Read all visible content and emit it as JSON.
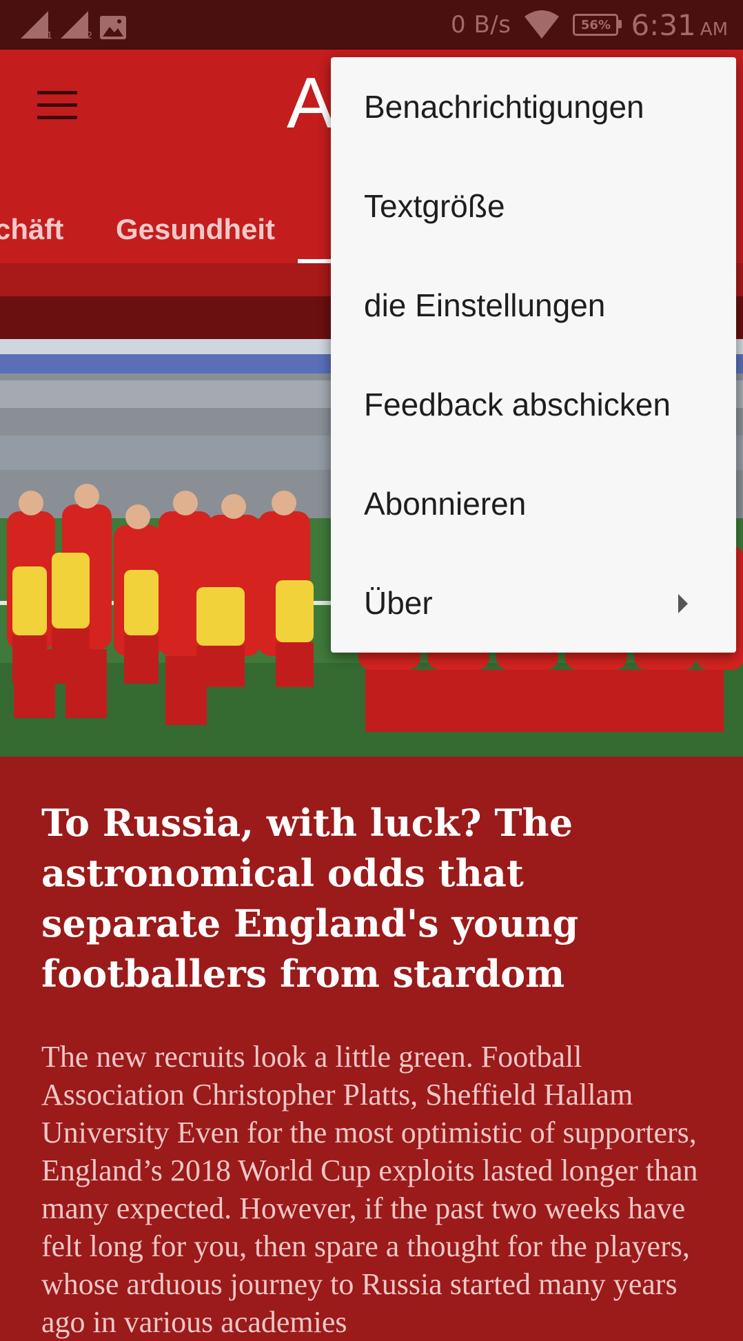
{
  "status_bar": {
    "sim1_label": "1",
    "sim2_label": "2",
    "net_speed": "0 B/s",
    "battery_level": "56%",
    "time": "6:31",
    "am_pm": "AM",
    "icons": [
      "signal-icon",
      "signal-icon",
      "image-icon",
      "wifi-icon",
      "battery-icon"
    ]
  },
  "app_bar": {
    "logo_text": "A",
    "icons": [
      "menu-icon"
    ],
    "tabs": [
      {
        "label": "chäft"
      },
      {
        "label": "Gesundheit"
      }
    ]
  },
  "popup_menu": {
    "items": [
      {
        "label": "Benachrichtigungen"
      },
      {
        "label": "Textgröße"
      },
      {
        "label": "die Einstellungen"
      },
      {
        "label": "Feedback abschicken"
      },
      {
        "label": "Abonnieren"
      },
      {
        "label": "Über"
      }
    ]
  },
  "article": {
    "headline": "To Russia, with luck? The astronomical odds that separate England's young footballers from stardom",
    "body": "The new recruits look a little green. Football Association Christopher Platts, Sheffield Hallam University Even for the most optimistic of supporters, England’s 2018 World Cup exploits lasted longer than many expected. However, if the past two weeks have felt long for you, then spare a thought for the players, whose arduous journey to Russia started many years ago in various academies"
  },
  "colors": {
    "status_bar_bg": "#4a0f0f",
    "app_bar_bg": "#c41d1d",
    "article_bg": "#9b1a1a",
    "menu_bg": "#f7f7f7",
    "menu_text": "#1e1e1e",
    "tab_text": "#f2c9c9"
  }
}
